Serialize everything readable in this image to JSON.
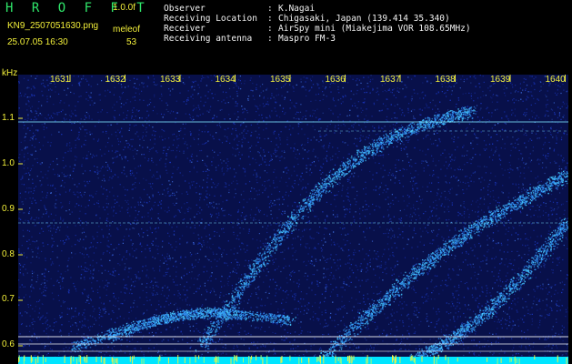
{
  "header": {
    "app_title": "H R O F F T",
    "version": "1.0.0f",
    "filename": "KN9_2507051630.png",
    "datetime": "25.07.05 16:30",
    "meleof_label": "meleof",
    "meleof_value": "53"
  },
  "metadata": {
    "rows": [
      {
        "key": "Observer",
        "value": "K.Nagai"
      },
      {
        "key": "Receiving Location",
        "value": "Chigasaki, Japan (139.414 35.340)"
      },
      {
        "key": "Receiver",
        "value": "AirSpy mini (Miakejima VOR 108.65MHz)"
      },
      {
        "key": "Receiving antenna",
        "value": "Maspro FM-3"
      }
    ]
  },
  "spectrogram": {
    "y_unit": "kHz",
    "y_ticks": [
      "1.1",
      "1.0",
      "0.9",
      "0.8",
      "0.7",
      "0.6"
    ],
    "time_labels": [
      "1631",
      "1632",
      "1633",
      "1634",
      "1635",
      "1636",
      "1637",
      "1638",
      "1639",
      "1640"
    ],
    "colors": {
      "background": "#08104a",
      "noise": "#1a35b8",
      "trace": "#46c8ff",
      "carrier": "#7fe8ff",
      "baseline": "#00e5ff",
      "marker": "#ffffff",
      "tick": "#f3f03a"
    }
  }
}
